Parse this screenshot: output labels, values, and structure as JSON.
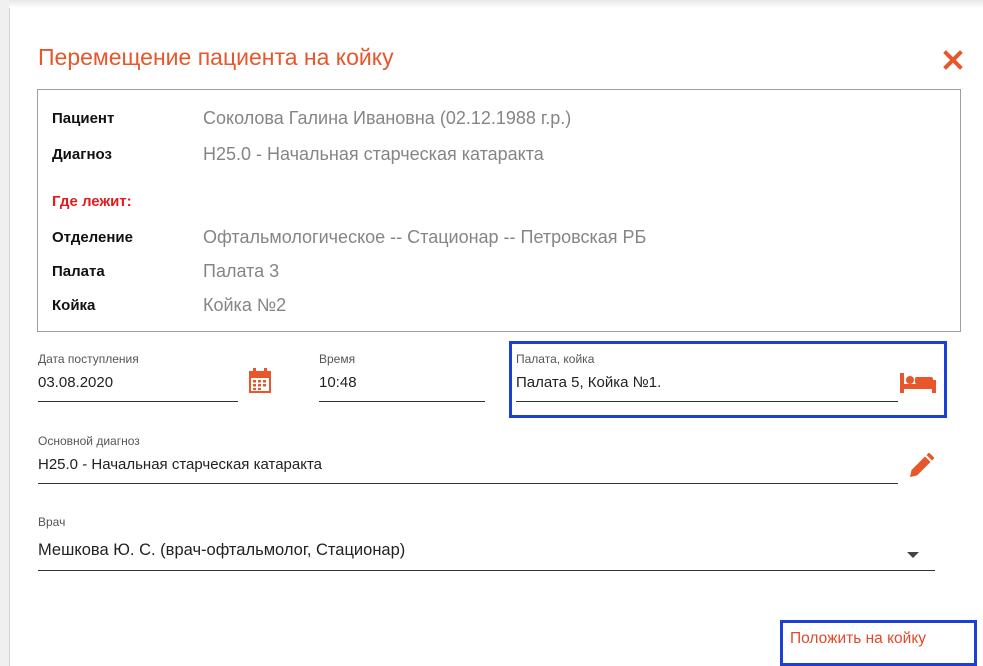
{
  "dialog": {
    "title": "Перемещение пациента на койку"
  },
  "patient_info": {
    "patient_label": "Пациент",
    "patient_value": "Соколова Галина Ивановна (02.12.1988 г.р.)",
    "diagnosis_label": "Диагноз",
    "diagnosis_value": "H25.0 - Начальная старческая катаракта",
    "location_heading": "Где лежит:",
    "department_label": "Отделение",
    "department_value": "Офтальмологическое -- Стационар -- Петровская РБ",
    "ward_label": "Палата",
    "ward_value": "Палата 3",
    "bed_label": "Койка",
    "bed_value": "Койка №2"
  },
  "form": {
    "admission_date_label": "Дата поступления",
    "admission_date_value": "03.08.2020",
    "time_label": "Время",
    "time_value": "10:48",
    "ward_bed_label": "Палата, койка",
    "ward_bed_value": "Палата 5, Койка №1.",
    "main_diagnosis_label": "Основной диагноз",
    "main_diagnosis_value": "H25.0 - Начальная старческая катаракта",
    "doctor_label": "Врач",
    "doctor_value": "Мешкова Ю. С. (врач-офтальмолог, Стационар)"
  },
  "actions": {
    "submit_label": "Положить на койку"
  },
  "icons": {
    "close": "close-icon",
    "calendar": "calendar-icon",
    "bed": "bed-icon",
    "edit": "pencil-icon",
    "dropdown": "dropdown-arrow-icon"
  },
  "colors": {
    "accent": "#e8562a",
    "warning_label": "#e41b1b",
    "highlight": "#1c3fd6",
    "value_gray": "#858585"
  }
}
